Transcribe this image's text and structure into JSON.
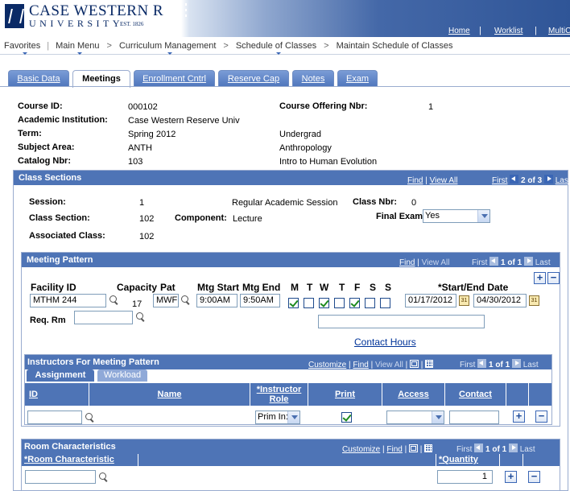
{
  "header": {
    "logo_line1": "CASE WESTERN R",
    "logo_line2": "UNIVERSITY",
    "logo_est": "EST. 1826",
    "links": [
      "Home",
      "Worklist",
      "MultiC"
    ]
  },
  "breadcrumb": {
    "items": [
      "Favorites",
      "Main Menu",
      "Curriculum Management",
      "Schedule of Classes",
      "Maintain Schedule of Classes"
    ]
  },
  "tabs": [
    {
      "label": "Basic Data",
      "active": false
    },
    {
      "label": "Meetings",
      "active": true
    },
    {
      "label": "Enrollment Cntrl",
      "active": false
    },
    {
      "label": "Reserve Cap",
      "active": false
    },
    {
      "label": "Notes",
      "active": false
    },
    {
      "label": "Exam",
      "active": false
    }
  ],
  "course": {
    "course_id_label": "Course ID:",
    "course_id": "000102",
    "offering_label": "Course Offering Nbr:",
    "offering": "1",
    "institution_label": "Academic Institution:",
    "institution": "Case Western Reserve Univ",
    "term_label": "Term:",
    "term": "Spring 2012",
    "career": "Undergrad",
    "subject_label": "Subject Area:",
    "subject": "ANTH",
    "subject_desc": "Anthropology",
    "catalog_label": "Catalog Nbr:",
    "catalog": "103",
    "catalog_desc": "Intro to Human Evolution"
  },
  "class_sections": {
    "title": "Class Sections",
    "find": "Find",
    "view_all": "View All",
    "first": "First",
    "position": "2 of 3",
    "last": "Last",
    "session_label": "Session:",
    "session": "1",
    "session_desc": "Regular Academic Session",
    "class_nbr_label": "Class Nbr:",
    "class_nbr": "0",
    "class_section_label": "Class Section:",
    "class_section": "102",
    "component_label": "Component:",
    "component": "Lecture",
    "final_exam_label": "Final Exam",
    "final_exam": "Yes",
    "assoc_label": "Associated Class:",
    "assoc": "102"
  },
  "meeting_pattern": {
    "title": "Meeting Pattern",
    "find": "Find",
    "view_all": "View All",
    "first": "First",
    "position": "1 of 1",
    "last": "Last",
    "facility_label": "Facility ID",
    "facility": "MTHM 244",
    "capacity_label": "Capacity",
    "capacity": "17",
    "pat_label": "Pat",
    "pat": "MWF",
    "mtg_start_label": "Mtg Start",
    "mtg_start": "9:00AM",
    "mtg_end_label": "Mtg End",
    "mtg_end": "9:50AM",
    "days": [
      {
        "label": "M",
        "checked": true
      },
      {
        "label": "T",
        "checked": false
      },
      {
        "label": "W",
        "checked": true
      },
      {
        "label": "T",
        "checked": false
      },
      {
        "label": "F",
        "checked": true
      },
      {
        "label": "S",
        "checked": false
      },
      {
        "label": "S",
        "checked": false
      }
    ],
    "dates_label": "*Start/End Date",
    "start_date": "01/17/2012",
    "end_date": "04/30/2012",
    "req_rm_label": "Req. Rm",
    "req_rm": "",
    "contact_hours": "Contact Hours",
    "add": "+",
    "remove": "−"
  },
  "instructors": {
    "title": "Instructors For Meeting Pattern",
    "customize": "Customize",
    "find": "Find",
    "view_all": "View All",
    "first": "First",
    "position": "1 of 1",
    "last": "Last",
    "subtabs": [
      "Assignment",
      "Workload"
    ],
    "columns": [
      "ID",
      "Name",
      "*Instructor Role",
      "Print",
      "Access",
      "Contact"
    ],
    "row": {
      "id": "",
      "name": "",
      "role": "Prim In:",
      "print": true,
      "access": "",
      "contact": ""
    },
    "add": "+",
    "remove": "−"
  },
  "room_chars": {
    "title": "Room Characteristics",
    "customize": "Customize",
    "find": "Find",
    "first": "First",
    "position": "1 of 1",
    "last": "Last",
    "col_char": "*Room Characteristic",
    "col_qty": "*Quantity",
    "row": {
      "char": "",
      "qty": "1"
    },
    "add": "+",
    "remove": "−"
  }
}
